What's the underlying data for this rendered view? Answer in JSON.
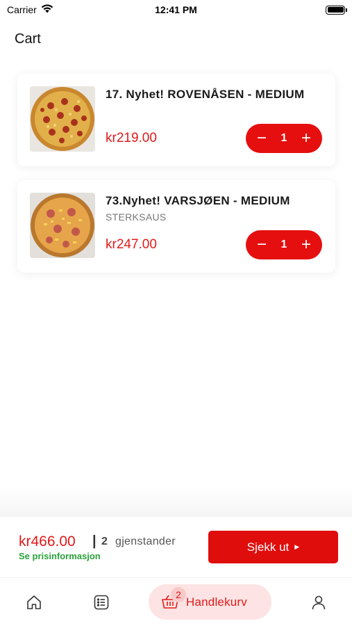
{
  "status_bar": {
    "carrier": "Carrier",
    "time": "12:41 PM"
  },
  "page": {
    "title": "Cart"
  },
  "cart_items": [
    {
      "name": "17.  Nyhet! ROVENÅSEN - MEDIUM",
      "option": "",
      "price": "kr219.00",
      "quantity": "1"
    },
    {
      "name": "73.Nyhet! VARSJØEN - MEDIUM",
      "option": "STERKSAUS",
      "price": "kr247.00",
      "quantity": "1"
    }
  ],
  "summary": {
    "total": "kr466.00",
    "divider": "|",
    "item_count": "2",
    "item_count_label": "gjenstander",
    "price_info_link": "Se prisinformasjon",
    "checkout_label": "Sjekk ut"
  },
  "tabbar": {
    "cart_label": "Handlekurv",
    "cart_badge": "2"
  },
  "colors": {
    "accent": "#e00d0d",
    "price": "#e01a1a",
    "link_green": "#29a33a",
    "active_tab_bg": "#fde3e3"
  },
  "icons": [
    "wifi-icon",
    "battery-icon",
    "minus-icon",
    "plus-icon",
    "caret-right-icon",
    "home-icon",
    "menu-list-icon",
    "basket-icon",
    "user-icon"
  ]
}
